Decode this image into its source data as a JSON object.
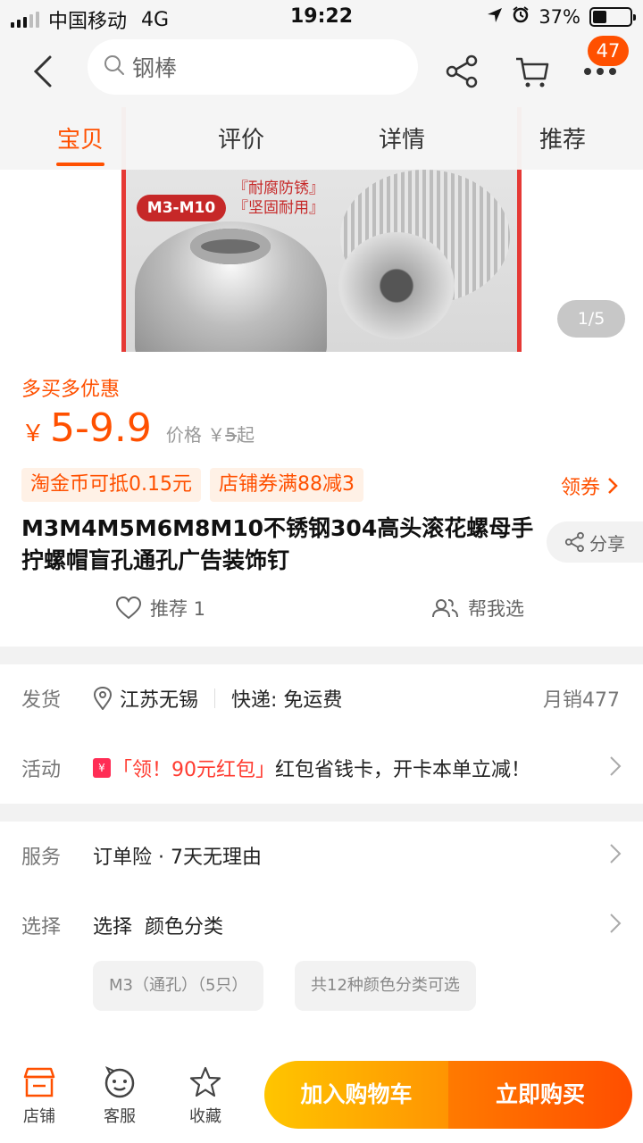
{
  "status": {
    "carrier": "中国移动",
    "network": "4G",
    "time": "19:22",
    "battery_pct_text": "37%",
    "battery_level": 0.37
  },
  "header": {
    "search_query": "钢棒",
    "badge_count": "47",
    "tabs": [
      "宝贝",
      "评价",
      "详情",
      "推荐"
    ],
    "active_tab": 0
  },
  "hero": {
    "size_tag": "M3-M10",
    "tagline_1": "『耐腐防锈』",
    "tagline_2": "『坚固耐用』",
    "pager": "1/5"
  },
  "price": {
    "promo_title": "多买多优惠",
    "currency": "￥",
    "range": "5-9.9",
    "orig_label": "价格",
    "orig_currency": "￥",
    "orig_value": "5",
    "orig_suffix": "起",
    "coupons": [
      "淘金币可抵0.15元",
      "店铺券满88减3"
    ],
    "get_coupon": "领券"
  },
  "product": {
    "title": "M3M4M5M6M8M10不锈钢304高头滚花螺母手拧螺帽盲孔通孔广告装饰钉",
    "share": "分享",
    "recommend": "推荐 1",
    "help_choose": "帮我选"
  },
  "shipping": {
    "label": "发货",
    "location": "江苏无锡",
    "express": "快递: 免运费",
    "monthly_sales": "月销477",
    "activity_label": "活动",
    "activity_highlight": "「领！90元红包」",
    "activity_text": "红包省钱卡，开卡本单立减！"
  },
  "service": {
    "label": "服务",
    "text": "订单险 · 7天无理由",
    "select_label": "选择",
    "select_text": "选择  颜色分类",
    "options": [
      "M3（通孔）（5只）",
      "共12种颜色分类可选"
    ]
  },
  "bottom": {
    "shop": "店铺",
    "service": "客服",
    "favorite": "收藏",
    "add_cart": "加入购物车",
    "buy_now": "立即购买"
  },
  "colors": {
    "accent": "#ff5000",
    "cart_gradient": [
      "#ffc500",
      "#ff9402"
    ],
    "buy_gradient": [
      "#ff7a00",
      "#ff4e00"
    ]
  }
}
